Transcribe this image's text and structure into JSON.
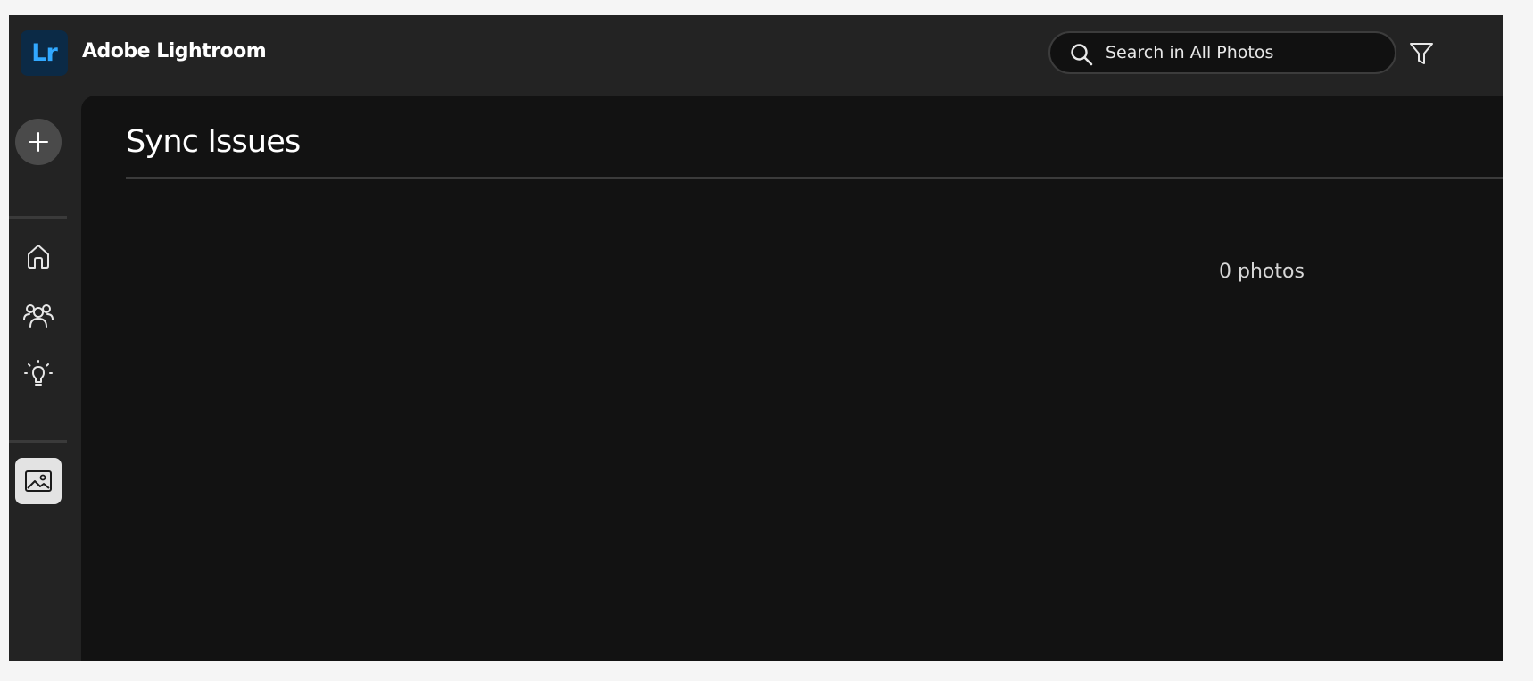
{
  "app": {
    "logo_text": "Lr",
    "title": "Adobe Lightroom",
    "brand_color": "#31a8ff",
    "logo_bg": "#0b2a46"
  },
  "search": {
    "placeholder": "Search in All Photos",
    "icon": "search-icon"
  },
  "toolbar": {
    "filter_icon": "filter-icon"
  },
  "rail": {
    "add_icon": "plus-icon",
    "items": [
      {
        "icon": "home-icon",
        "active": false
      },
      {
        "icon": "people-icon",
        "active": false
      },
      {
        "icon": "lightbulb-icon",
        "active": false
      },
      {
        "icon": "photos-icon",
        "active": true
      }
    ]
  },
  "main": {
    "title": "Sync Issues",
    "photo_count": "0 photos"
  }
}
